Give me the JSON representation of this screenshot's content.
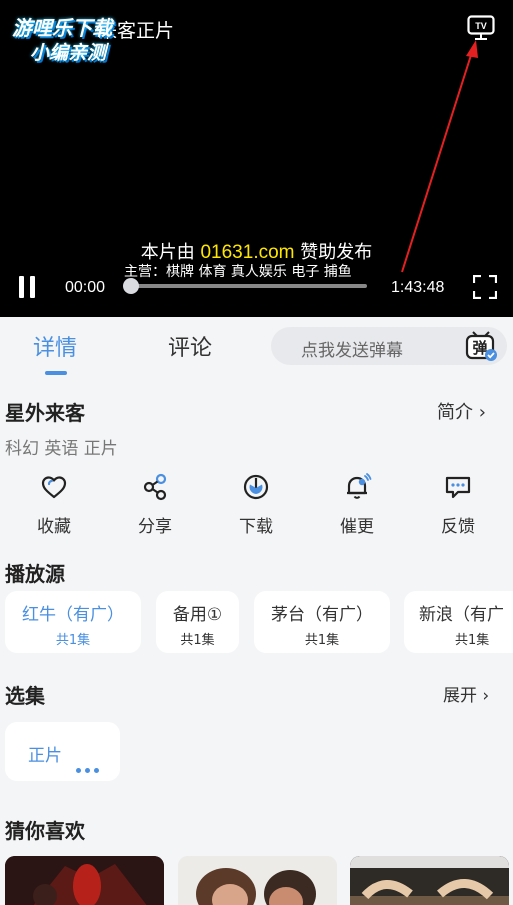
{
  "player": {
    "watermark_line1": "游哩乐下载",
    "watermark_line2": "小编亲测",
    "title_partial": "来客正片",
    "cast_icon_text": "TV",
    "sponsor_prefix": "本片由 ",
    "sponsor_site": "01631.com",
    "sponsor_suffix": " 赞助发布",
    "ad_subtitle": "主营：棋牌 体育 真人娱乐  电子 捕鱼",
    "current_time": "00:00",
    "duration": "1:43:48",
    "progress_fraction": 0.0
  },
  "tabs": [
    {
      "label": "详情",
      "active": true
    },
    {
      "label": "评论",
      "active": false
    }
  ],
  "danmaku": {
    "placeholder": "点我发送弹幕",
    "icon_text": "弹"
  },
  "details": {
    "title": "星外来客",
    "intro_label": "简介 ›",
    "tags": "科幻 英语 正片"
  },
  "actions": [
    {
      "label": "收藏",
      "icon": "heart-icon"
    },
    {
      "label": "分享",
      "icon": "share-icon"
    },
    {
      "label": "下载",
      "icon": "download-icon"
    },
    {
      "label": "催更",
      "icon": "bell-icon"
    },
    {
      "label": "反馈",
      "icon": "feedback-icon"
    }
  ],
  "sources": {
    "heading": "播放源",
    "items": [
      {
        "name": "红牛（有广）",
        "count": "共1集",
        "active": true
      },
      {
        "name": "备用①",
        "count": "共1集",
        "active": false
      },
      {
        "name": "茅台（有广）",
        "count": "共1集",
        "active": false
      },
      {
        "name": "新浪（有广",
        "count": "共1集",
        "active": false
      }
    ]
  },
  "episodes": {
    "heading": "选集",
    "expand_label": "展开 ›",
    "items": [
      {
        "label": "正片"
      }
    ]
  },
  "recommend": {
    "heading": "猜你喜欢"
  },
  "colors": {
    "accent": "#4a8fe0",
    "annotation_arrow": "#e52020",
    "sponsor_highlight": "#ffe600"
  }
}
